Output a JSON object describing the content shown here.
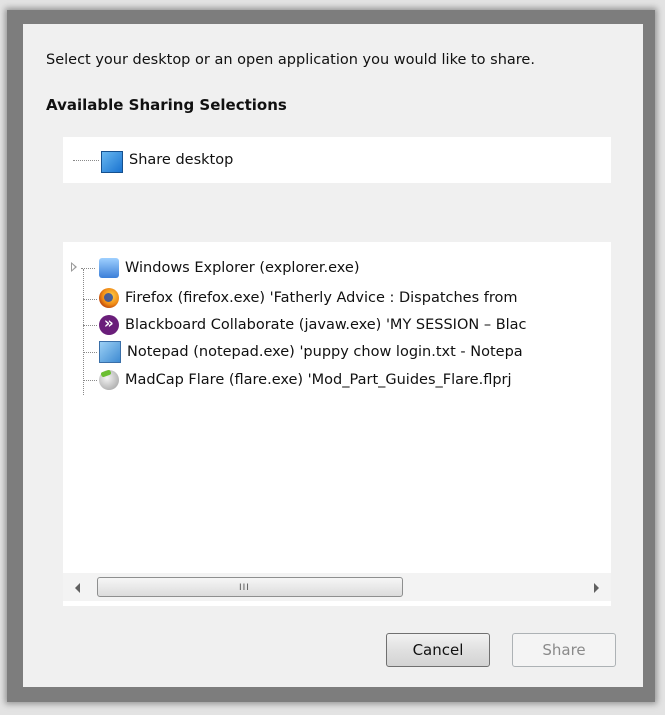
{
  "dialog": {
    "instruction": "Select your desktop or an open application you would like to share.",
    "heading": "Available Sharing Selections"
  },
  "desktop": {
    "label": "Share desktop",
    "icon": "monitor-icon"
  },
  "applications": [
    {
      "label": "Windows Explorer (explorer.exe)",
      "icon": "windows-explorer-icon"
    },
    {
      "label": "Firefox (firefox.exe) 'Fatherly Advice : Dispatches from",
      "icon": "firefox-icon"
    },
    {
      "label": "Blackboard Collaborate (javaw.exe) 'MY SESSION – Blac",
      "icon": "blackboard-collaborate-icon"
    },
    {
      "label": "Notepad (notepad.exe) 'puppy chow login.txt - Notepa",
      "icon": "notepad-icon"
    },
    {
      "label": "MadCap Flare (flare.exe) 'Mod_Part_Guides_Flare.flprj",
      "icon": "madcap-flare-icon"
    }
  ],
  "scrollbar": {
    "grip": "III"
  },
  "buttons": {
    "cancel": "Cancel",
    "share": "Share"
  }
}
